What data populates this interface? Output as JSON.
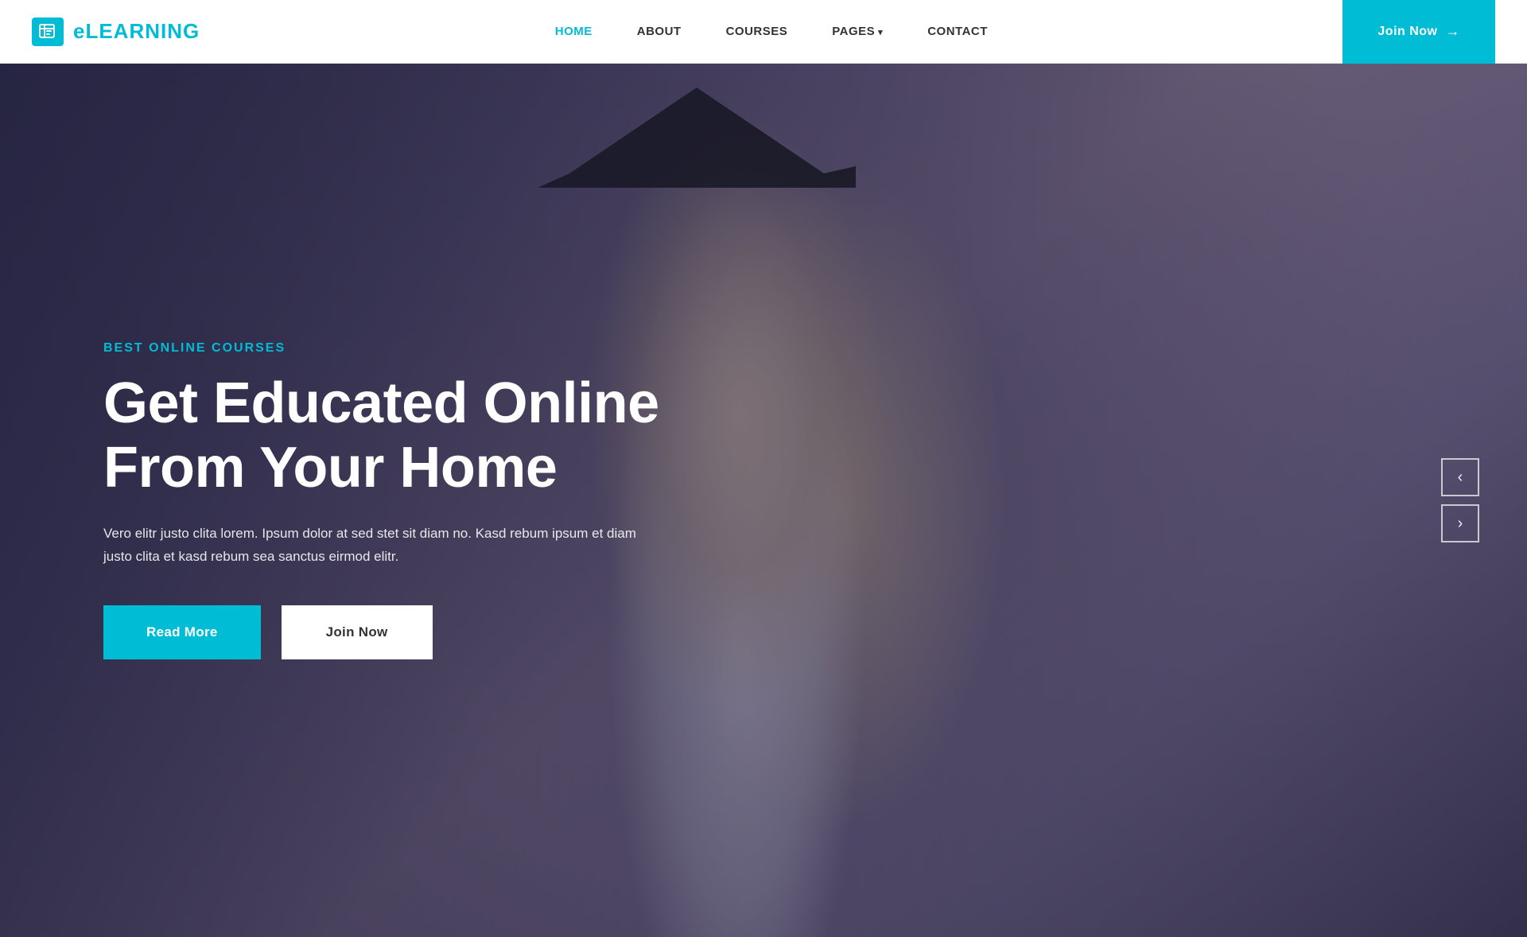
{
  "header": {
    "logo_text": "eLEARNING",
    "nav": {
      "home": "HOME",
      "about": "ABOUT",
      "courses": "COURSES",
      "pages": "PAGES",
      "contact": "CONTACT"
    },
    "join_now": "Join Now",
    "arrow": "→"
  },
  "hero": {
    "subtitle": "BEST ONLINE COURSES",
    "title_line1": "Get Educated Online",
    "title_line2": "From Your Home",
    "description": "Vero elitr justo clita lorem. Ipsum dolor at sed stet sit diam no. Kasd rebum ipsum\net diam justo clita et kasd rebum sea sanctus eirmod elitr.",
    "btn_read_more": "Read More",
    "btn_join_now": "Join Now",
    "arrow_prev": "‹",
    "arrow_next": "›"
  },
  "colors": {
    "accent": "#00bcd4",
    "white": "#ffffff",
    "dark": "#333333"
  }
}
